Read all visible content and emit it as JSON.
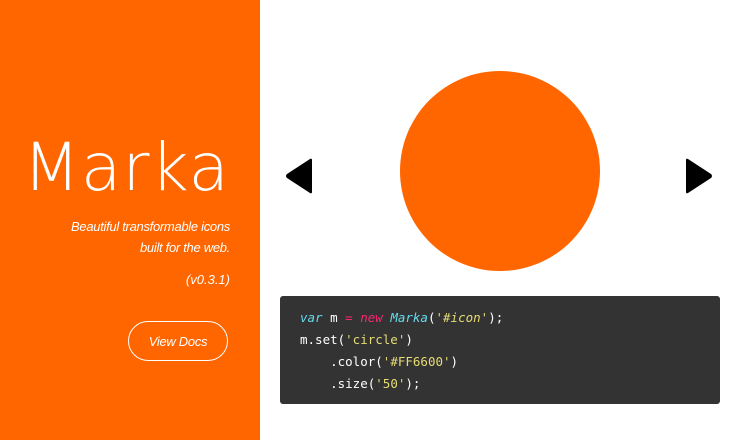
{
  "sidebar": {
    "title": "Marka",
    "tagline_line1": "Beautiful transformable icons",
    "tagline_line2": "built for the web.",
    "version": "(v0.3.1)",
    "docs_button_label": "View Docs",
    "background_color": "#FF6600"
  },
  "stage": {
    "prev_icon": "triangle-left-icon",
    "next_icon": "triangle-right-icon",
    "preview_icon": "circle",
    "preview_color": "#FF6600",
    "preview_size": "50"
  },
  "code": {
    "line1": {
      "kw_var": "var",
      "name": " m ",
      "op_eq": "=",
      "space": " ",
      "kw_new": "new",
      "space2": " ",
      "cls": "Marka",
      "paren_open": "(",
      "arg": "'#icon'",
      "paren_close": ");"
    },
    "line2": {
      "obj": "m.set(",
      "arg": "'circle'",
      "close": ")"
    },
    "line3": {
      "method": "    .color(",
      "arg": "'#FF6600'",
      "close": ")"
    },
    "line4": {
      "method": "    .size(",
      "arg": "'50'",
      "close": ");"
    }
  }
}
